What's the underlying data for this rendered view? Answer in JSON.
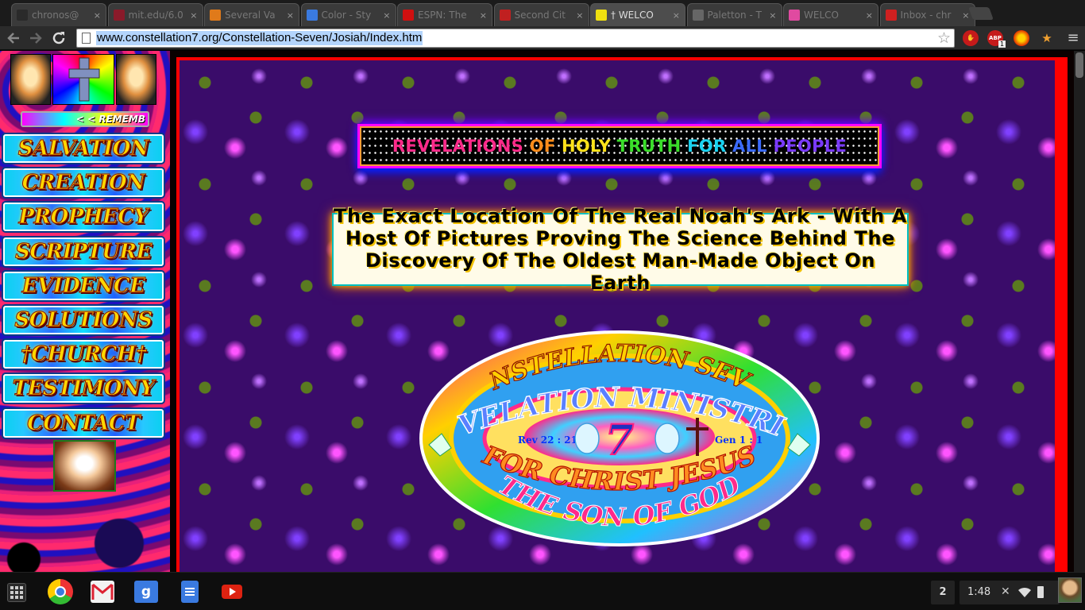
{
  "tabs": [
    {
      "label": "chronos@",
      "favicon_color": "#2a2a2a",
      "active": false
    },
    {
      "label": "mit.edu/6.0",
      "favicon_color": "#8a1a2a",
      "active": false
    },
    {
      "label": "Several Va",
      "favicon_color": "#e07a1a",
      "active": false
    },
    {
      "label": "Color - Sty",
      "favicon_color": "#3a7ae0",
      "active": false
    },
    {
      "label": "ESPN: The",
      "favicon_color": "#d01010",
      "active": false
    },
    {
      "label": "Second Cit",
      "favicon_color": "#c02020",
      "active": false
    },
    {
      "label": "† WELCO",
      "favicon_color": "#f0e010",
      "active": true
    },
    {
      "label": "Paletton - T",
      "favicon_color": "#666666",
      "active": false
    },
    {
      "label": "WELCO",
      "favicon_color": "#e04aa0",
      "active": false
    },
    {
      "label": "Inbox - chr",
      "favicon_color": "#d02020",
      "active": false
    }
  ],
  "toolbar": {
    "url": "www.constellation7.org/Constellation-Seven/Josiah/Index.htm",
    "bookmark_icon": "star-icon",
    "abp_label": "ABP",
    "abp_count": "1",
    "menu_icon": "hamburger-icon"
  },
  "sidebar": {
    "remember_text": "< < REMEMB",
    "nav": [
      {
        "label": "SALVATION"
      },
      {
        "label": "CREATION"
      },
      {
        "label": "PROPHECY"
      },
      {
        "label": "SCRIPTURE"
      },
      {
        "label": "EVIDENCE"
      },
      {
        "label": "SOLUTIONS"
      },
      {
        "label": "†CHURCH†"
      },
      {
        "label": "TESTIMONY"
      },
      {
        "label": "CONTACT"
      }
    ]
  },
  "main": {
    "banner_words": [
      {
        "text": "REVELATIONS",
        "color": "#ff2a8a"
      },
      {
        "text": "OF",
        "color": "#ff8c1a"
      },
      {
        "text": "HOLY",
        "color": "#ffe21a"
      },
      {
        "text": "TRUTH",
        "color": "#3ade2a"
      },
      {
        "text": "FOR",
        "color": "#1ad2f0"
      },
      {
        "text": "ALL",
        "color": "#3a6aff"
      },
      {
        "text": "PEOPLE",
        "color": "#7a3aff"
      }
    ],
    "headline": "The Exact Location Of The Real Noah's Ark - With A Host Of Pictures Proving The Science Behind The Discovery Of The Oldest Man-Made Object On Earth",
    "logo": {
      "top_text": "CONSTELLATION SEVEN",
      "middle_text": "REVELATION MINISTRIES",
      "left_ref": "Rev 22 : 21",
      "right_ref": "Gen 1 : 1",
      "number": "7",
      "bottom_text1": "FOR CHRIST JESUS",
      "bottom_text2": "THE SON OF GOD"
    }
  },
  "taskbar": {
    "apps": [
      "chrome-icon",
      "gmail-icon",
      "google-search-icon",
      "docs-icon",
      "youtube-icon"
    ],
    "notification_count": "2",
    "time": "1:48"
  }
}
